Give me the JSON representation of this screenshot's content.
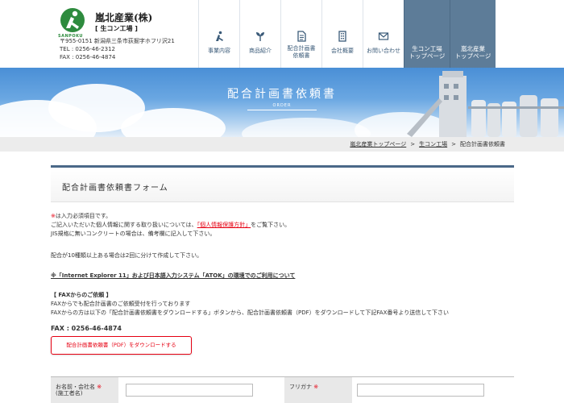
{
  "header": {
    "logo_text": "SANPOKU",
    "company_name": "嵐北産業(株)",
    "plant_name": "[ 生コン工場 ]",
    "address": "〒955-0151 新潟県三条市荻掘字ホフリ沢21",
    "tel": "TEL : 0256-46-2312",
    "fax": "FAX : 0256-46-4874"
  },
  "nav": {
    "items": [
      {
        "label": "事業内容",
        "icon": "person-icon"
      },
      {
        "label": "商品紹介",
        "icon": "sprout-icon"
      },
      {
        "label_line1": "配合計画書",
        "label_line2": "依頼書",
        "icon": "document-icon"
      },
      {
        "label": "会社概要",
        "icon": "building-icon"
      },
      {
        "label": "お問い合わせ",
        "icon": "mail-icon"
      }
    ],
    "top_pages": [
      {
        "line1": "生コン工場",
        "line2": "トップページ"
      },
      {
        "line1": "嵐北産業",
        "line2": "トップページ"
      }
    ]
  },
  "banner": {
    "title": "配合計画書依頼書",
    "subtitle": "ORDER"
  },
  "breadcrumb": {
    "items": [
      "嵐北産業トップページ",
      "生コン工場",
      "配合計画書依頼書"
    ],
    "separator": ">"
  },
  "form": {
    "title": "配合計画書依頼書フォーム",
    "required_mark": "※",
    "required_note": "は入力必須項目です。",
    "privacy_prefix": "ご記入いただいた個人情報に関する取り扱いについては、",
    "privacy_link": "「個人情報保護方針」",
    "privacy_suffix": "をご覧下さい。",
    "jis_note": "JIS規格に無いコンクリートの場合は、備考欄に記入して下さい。",
    "split_note": "配合が10種類以上ある場合は2回に分けて作成して下さい。",
    "ie_note": "※「Internet Explorer 11」および日本語入力システム「ATOK」の環境でのご利用について",
    "fax_heading": "【 FAXからのご依頼 】",
    "fax_line1": "FAXからでも配合計画書のご依頼受付を行っております",
    "fax_line2": "FAXからの方は以下の「配合計画書依頼書をダウンロードする」ボタンから、配合計画書依頼書（PDF）をダウンロードして下記FAX番号より送信して下さい",
    "fax_number": "FAX : 0256-46-4874",
    "pdf_button": "配合計画書依頼書（PDF）をダウンロードする",
    "fields": {
      "name_label_line1": "お名前・会社名",
      "name_label_line2": "(施工者名)",
      "furigana_label": "フリガナ",
      "required": "※",
      "name_value": "",
      "furigana_value": ""
    }
  },
  "colors": {
    "nav_dark": "#5d7c98",
    "accent_red": "#e60012",
    "brand_green": "#2e8b3e",
    "title_border": "#4a6888"
  }
}
